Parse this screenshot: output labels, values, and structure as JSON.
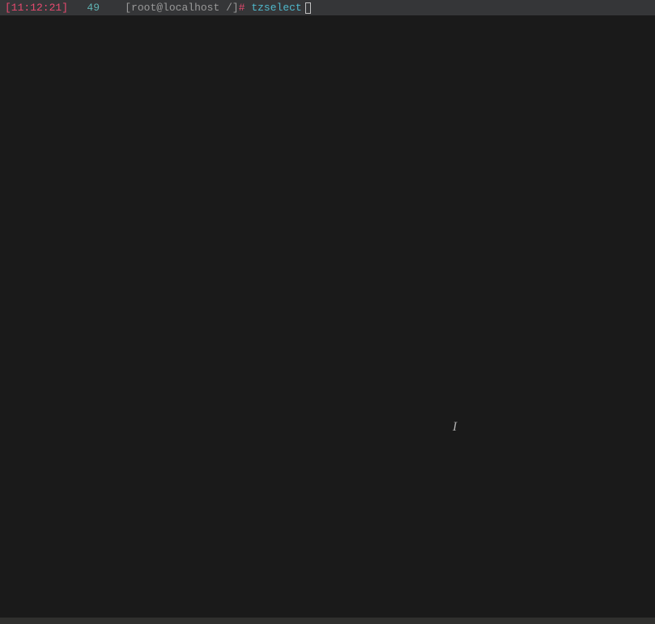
{
  "prompt": {
    "timestamp": "[11:12:21]",
    "history_number": "49",
    "context": "[root@localhost /]",
    "hash": "#",
    "command": "tzselect"
  }
}
